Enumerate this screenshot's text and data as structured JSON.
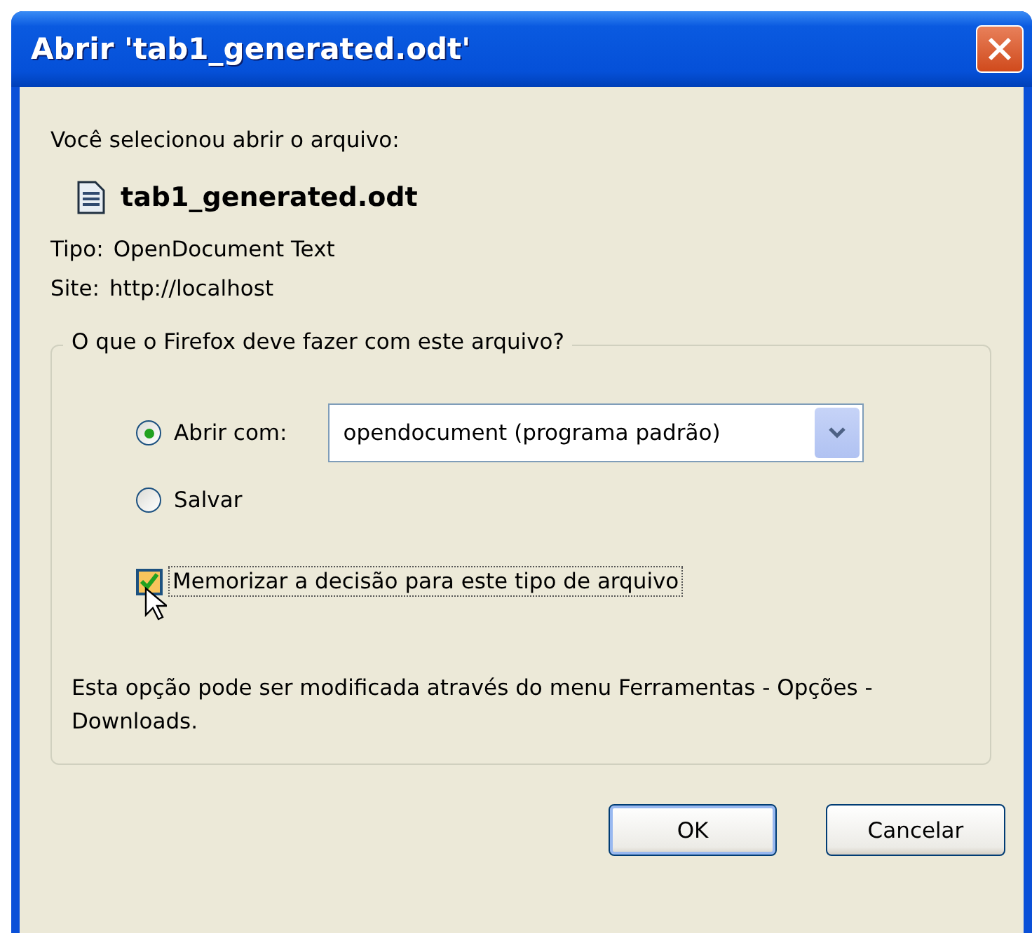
{
  "window": {
    "title": "Abrir 'tab1_generated.odt'"
  },
  "intro": "Você selecionou abrir o arquivo:",
  "file": {
    "name": "tab1_generated.odt"
  },
  "details": [
    {
      "label": "Tipo:",
      "value": "OpenDocument Text"
    },
    {
      "label": "Site:",
      "value": "http://localhost"
    }
  ],
  "action_group": {
    "legend": "O que o Firefox deve fazer com este arquivo?",
    "options": [
      {
        "label": "Abrir com:",
        "selected": true,
        "kind": "app"
      },
      {
        "label": "Salvar",
        "selected": false,
        "kind": "plain"
      }
    ],
    "app_select": {
      "value": "opendocument (programa padrão)"
    },
    "remember": {
      "label": "Memorizar a decisão para este tipo de arquivo",
      "checked": true,
      "focused": true
    },
    "note": "Esta opção pode ser modificada através do menu Ferramentas - Opções - Downloads."
  },
  "buttons": [
    {
      "label": "OK",
      "default": true
    },
    {
      "label": "Cancelar",
      "default": false
    }
  ]
}
